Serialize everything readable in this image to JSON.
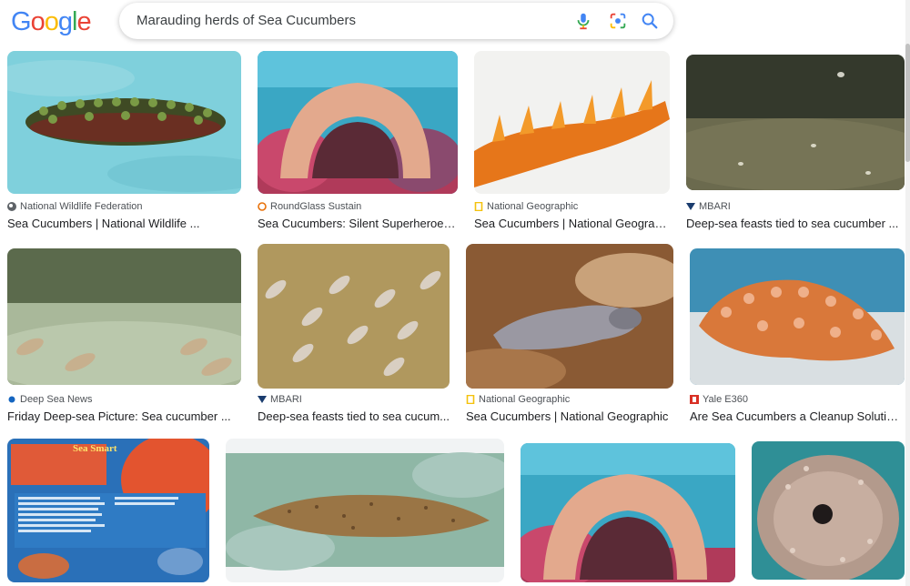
{
  "header": {
    "logo_letters": [
      "G",
      "o",
      "o",
      "g",
      "l",
      "e"
    ],
    "logo_colors": [
      "#4285F4",
      "#EA4335",
      "#FBBC05",
      "#4285F4",
      "#34A853",
      "#EA4335"
    ],
    "search_query": "Marauding herds of Sea Cucumbers",
    "icons": [
      "microphone-icon",
      "lens-icon",
      "search-icon"
    ]
  },
  "results": [
    {
      "source": "National Wildlife Federation",
      "title": "Sea Cucumbers | National Wildlife ...",
      "favicon": "nwf-favicon"
    },
    {
      "source": "RoundGlass Sustain",
      "title": "Sea Cucumbers: Silent Superheroes ...",
      "favicon": "roundglass-favicon"
    },
    {
      "source": "National Geographic",
      "title": "Sea Cucumbers | National Geograp...",
      "favicon": "natgeo-favicon"
    },
    {
      "source": "MBARI",
      "title": "Deep-sea feasts tied to sea cucumber ...",
      "favicon": "mbari-favicon"
    },
    {
      "source": "Deep Sea News",
      "title": "Friday Deep-sea Picture: Sea cucumber ...",
      "favicon": "deepseanews-favicon"
    },
    {
      "source": "MBARI",
      "title": "Deep-sea feasts tied to sea cucum...",
      "favicon": "mbari-favicon"
    },
    {
      "source": "National Geographic",
      "title": "Sea Cucumbers | National Geographic",
      "favicon": "natgeo-favicon"
    },
    {
      "source": "Yale E360",
      "title": "Are Sea Cucumbers a Cleanup Solution...",
      "favicon": "yale-favicon"
    },
    {
      "source": "",
      "title": "",
      "favicon": ""
    },
    {
      "source": "",
      "title": "",
      "favicon": ""
    },
    {
      "source": "",
      "title": "",
      "favicon": ""
    },
    {
      "source": "",
      "title": "",
      "favicon": ""
    }
  ],
  "infographic": {
    "heading": "Sea Smart"
  },
  "colors": {
    "favicon_nwf": "#5f6368",
    "favicon_roundglass": "#e8710a",
    "favicon_natgeo": "#f4c20d",
    "favicon_mbari": "#1a3c6e",
    "favicon_deepseanews": "#1565c0",
    "favicon_yale": "#d93025"
  }
}
